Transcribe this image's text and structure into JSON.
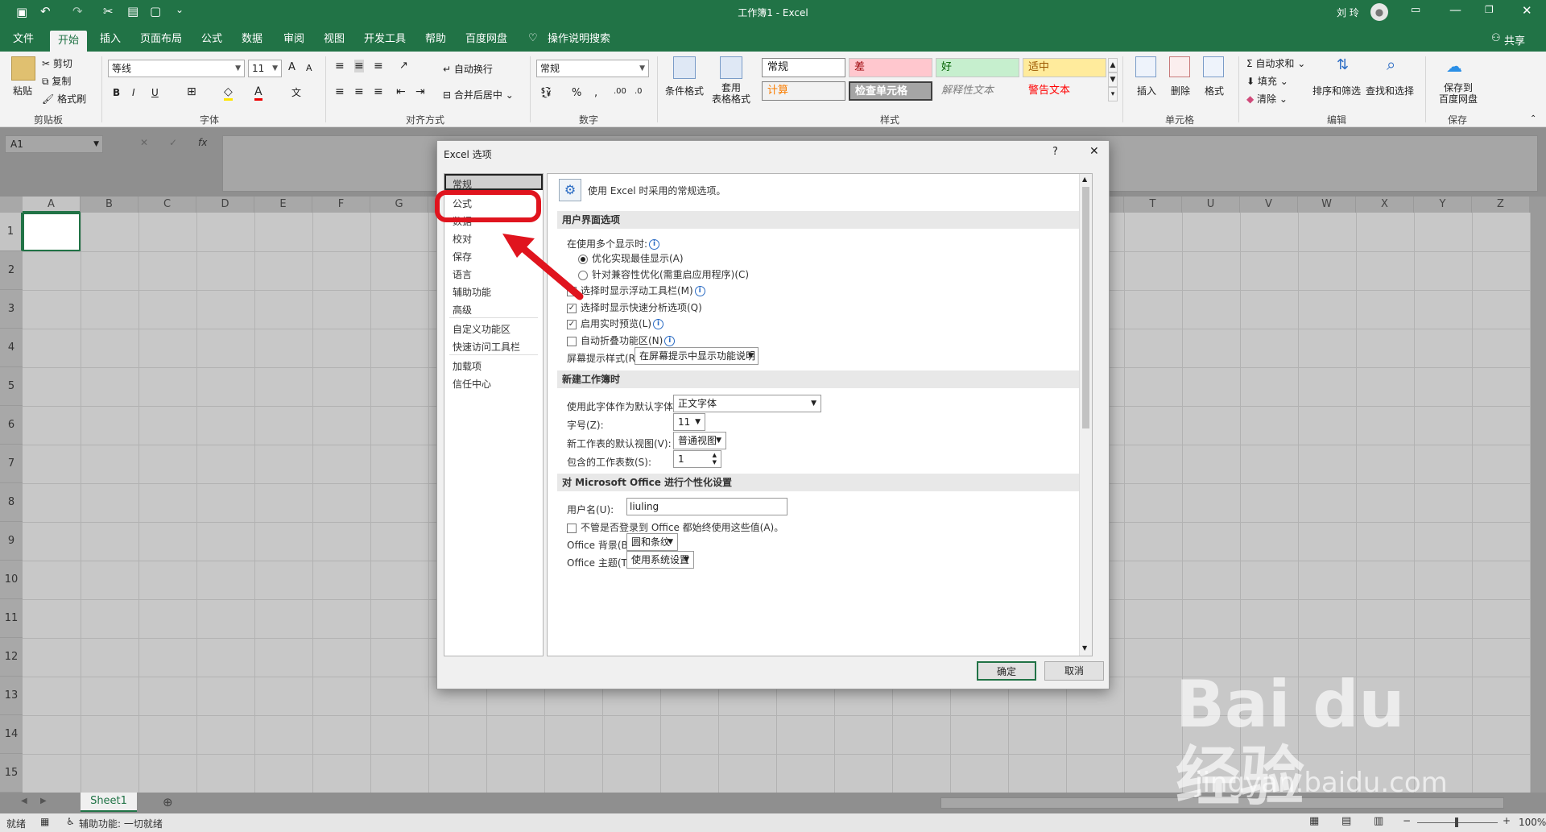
{
  "titlebar": {
    "title": "工作簿1 - Excel",
    "user": "刘 玲"
  },
  "tabs": [
    "文件",
    "开始",
    "插入",
    "页面布局",
    "公式",
    "数据",
    "审阅",
    "视图",
    "开发工具",
    "帮助",
    "百度网盘",
    "操作说明搜索"
  ],
  "share": "共享",
  "ribbon": {
    "clipboard": {
      "paste": "粘贴",
      "cut": "剪切",
      "copy": "复制",
      "format_painter": "格式刷",
      "label": "剪贴板"
    },
    "font": {
      "name": "等线",
      "size": "11",
      "label": "字体",
      "bold": "B",
      "italic": "I",
      "underline": "U",
      "grow": "A",
      "shrink": "A"
    },
    "align": {
      "wrap": "自动换行",
      "merge": "合并后居中",
      "label": "对齐方式"
    },
    "number": {
      "format": "常规",
      "percent": "%",
      "comma": ",",
      "label": "数字"
    },
    "styles": {
      "cond": "条件格式",
      "table": "套用\n表格格式",
      "label": "样式",
      "cells": [
        "常规",
        "差",
        "好",
        "适中",
        "计算",
        "检查单元格",
        "解释性文本",
        "警告文本"
      ]
    },
    "cells": {
      "insert": "插入",
      "delete": "删除",
      "format": "格式",
      "label": "单元格"
    },
    "editing": {
      "autosum": "自动求和",
      "fill": "填充",
      "clear": "清除",
      "sort": "排序和筛选",
      "find": "查找和选择",
      "label": "编辑"
    },
    "save": {
      "btn": "保存到\n百度网盘",
      "label": "保存"
    }
  },
  "namebox": "A1",
  "fx": "fx",
  "columns": [
    "A",
    "B",
    "C",
    "D",
    "E",
    "F",
    "G",
    "H",
    "I",
    "J",
    "K",
    "L",
    "M",
    "N",
    "O",
    "P",
    "Q",
    "R",
    "S",
    "T",
    "U",
    "V",
    "W",
    "X",
    "Y",
    "Z"
  ],
  "rows": [
    "1",
    "2",
    "3",
    "4",
    "5",
    "6",
    "7",
    "8",
    "9",
    "10",
    "11",
    "12",
    "13",
    "14",
    "15"
  ],
  "sheet": "Sheet1",
  "status": {
    "ready": "就绪",
    "access": "辅助功能: 一切就绪",
    "zoom": "100%"
  },
  "dialog": {
    "title": "Excel 选项",
    "help": "?",
    "close": "✕",
    "nav": [
      "常规",
      "公式",
      "数据",
      "校对",
      "保存",
      "语言",
      "辅助功能",
      "高级",
      "自定义功能区",
      "快速访问工具栏",
      "加载项",
      "信任中心"
    ],
    "header": "使用 Excel 时采用的常规选项。",
    "sec1": "用户界面选项",
    "multi_display": "在使用多个显示时:",
    "opt_best": "优化实现最佳显示(A)",
    "opt_compat": "针对兼容性优化(需重启应用程序)(C)",
    "chk1": "选择时显示浮动工具栏(M)",
    "chk2": "选择时显示快速分析选项(Q)",
    "chk3": "启用实时预览(L)",
    "chk4": "自动折叠功能区(N)",
    "tip_label": "屏幕提示样式(R):",
    "tip_value": "在屏幕提示中显示功能说明",
    "sec2": "新建工作簿时",
    "font_label": "使用此字体作为默认字体(N):",
    "font_value": "正文字体",
    "size_label": "字号(Z):",
    "size_value": "11",
    "view_label": "新工作表的默认视图(V):",
    "view_value": "普通视图",
    "sheets_label": "包含的工作表数(S):",
    "sheets_value": "1",
    "sec3": "对 Microsoft Office 进行个性化设置",
    "user_label": "用户名(U):",
    "user_value": "liuling",
    "always_use": "不管是否登录到 Office 都始终使用这些值(A)。",
    "bg_label": "Office 背景(B):",
    "bg_value": "圆和条纹",
    "theme_label": "Office 主题(T):",
    "theme_value": "使用系统设置",
    "ok": "确定",
    "cancel": "取消"
  },
  "watermark": {
    "brand": "Bai du 经验",
    "url": "jingyan.baidu.com"
  },
  "colors": {
    "excel_green": "#217346",
    "highlight_red": "#e0141e"
  }
}
